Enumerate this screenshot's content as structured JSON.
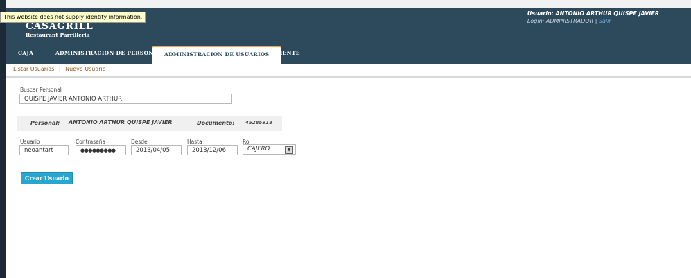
{
  "identity_notice": "This website does not supply identity information.",
  "brand": {
    "name": "CASAGRILL",
    "subtitle": "Restaurant Parrilleria"
  },
  "user": {
    "name_label": "Usuario: ANTONIO ARTHUR QUISPE JAVIER",
    "login_label": "Login: ADMINISTRADOR",
    "separator": "|",
    "logout": "Salir"
  },
  "tabs": [
    {
      "label": "CAJA"
    },
    {
      "label": "ADMINISTRACION DE PERSONAL"
    },
    {
      "label": "ADMINISTRACION DE USUARIOS"
    },
    {
      "label": "CLIENTE"
    }
  ],
  "subnav": {
    "list": "Listar Usuarios",
    "sep": "|",
    "new": "Nuevo Usuario"
  },
  "search": {
    "label": "Buscar Personal",
    "value": "QUISPE JAVIER ANTONIO ARTHUR"
  },
  "personal": {
    "label": "Personal:",
    "name": "ANTONIO ARTHUR QUISPE JAVIER",
    "doc_label": "Documento:",
    "doc_value": "45285918"
  },
  "form": {
    "usuario_label": "Usuario",
    "usuario_value": "neoantart",
    "password_label": "Contraseña",
    "password_value": "●●●●●●●●●",
    "desde_label": "Desde",
    "desde_value": "2013/04/05",
    "hasta_label": "Hasta",
    "hasta_value": "2013/12/06",
    "rol_label": "Rol",
    "rol_value": "CAJERO"
  },
  "create_button": "Crear Usuario",
  "colors": {
    "header": "#2c4a5c",
    "accent": "#e8a452",
    "button": "#29a6cf"
  }
}
